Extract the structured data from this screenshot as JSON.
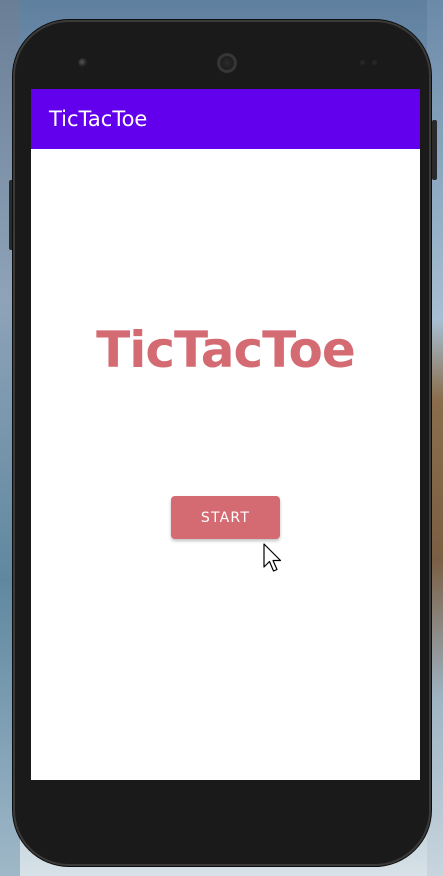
{
  "app": {
    "toolbar_title": "TicTacToe",
    "heading": "TicTacToe",
    "start_button_label": "START"
  },
  "colors": {
    "app_bar": "#6200ee",
    "accent": "#d46a72",
    "screen_background": "#ffffff"
  },
  "icons": {
    "cursor": "mouse-pointer-icon"
  }
}
